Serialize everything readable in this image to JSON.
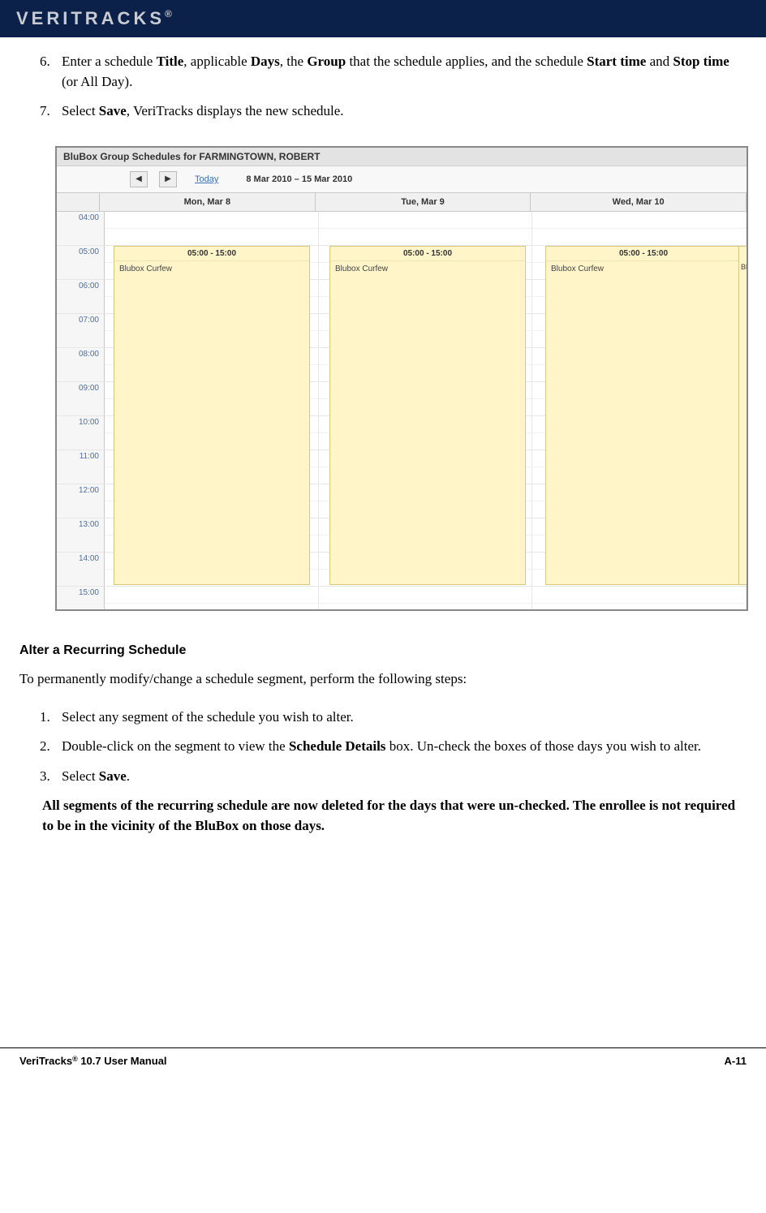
{
  "header": {
    "logo": "VERITRACKS",
    "reg": "®"
  },
  "steps_top": [
    {
      "num": "6.",
      "parts": [
        "Enter a schedule ",
        "Title",
        ", applicable ",
        "Days",
        ", the ",
        "Group",
        " that the schedule applies, and the schedule ",
        "Start time",
        " and ",
        "Stop time",
        " (or All Day)."
      ]
    },
    {
      "num": "7.",
      "parts": [
        "Select ",
        "Save",
        ", VeriTracks displays the new schedule."
      ]
    }
  ],
  "screenshot": {
    "title": "BluBox Group Schedules for FARMINGTOWN, ROBERT",
    "nav": {
      "prev": "◀",
      "next": "▶",
      "today": "Today",
      "range": "8 Mar 2010 – 15 Mar 2010"
    },
    "days": [
      "Mon, Mar 8",
      "Tue, Mar 9",
      "Wed, Mar 10"
    ],
    "times": [
      "04:00",
      "05:00",
      "06:00",
      "07:00",
      "08:00",
      "09:00",
      "10:00",
      "11:00",
      "12:00",
      "13:00",
      "14:00",
      "15:00"
    ],
    "event": {
      "time": "05:00 - 15:00",
      "name": "Blubox Curfew"
    },
    "partial_text": "Blu"
  },
  "section_heading": "Alter a Recurring Schedule",
  "intro_para": "To permanently modify/change a schedule segment, perform the following steps:",
  "steps_lower": [
    {
      "num": "1.",
      "parts": [
        "Select any segment of the schedule you wish to alter."
      ]
    },
    {
      "num": "2.",
      "parts": [
        "Double-click on the segment to view the ",
        "Schedule Details",
        " box.  Un-check the boxes of those days you wish to alter."
      ]
    },
    {
      "num": "3.",
      "parts": [
        "Select ",
        "Save",
        "."
      ]
    }
  ],
  "bold_para": "All segments of the recurring schedule are now deleted for the days that were un-checked.  The enrollee is not required to be in the vicinity of the BluBox on those days.",
  "footer": {
    "left_a": "VeriTracks",
    "sup": "®",
    "left_b": " 10.7 User Manual",
    "right": "A-11"
  }
}
